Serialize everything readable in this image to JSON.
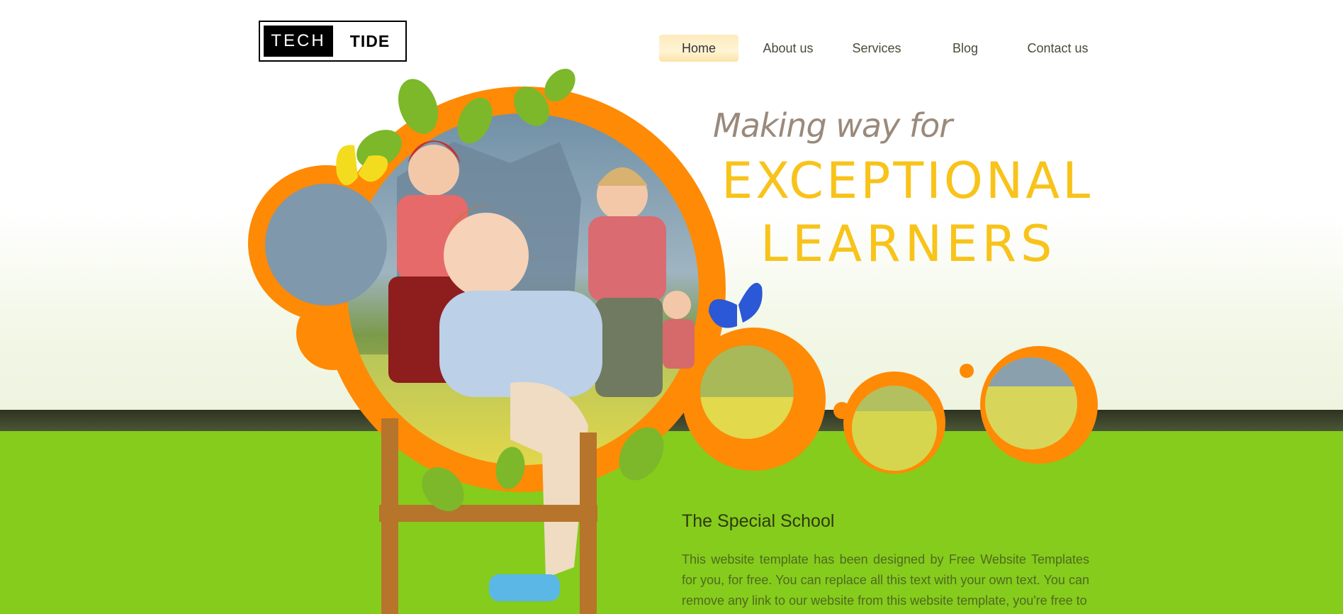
{
  "logo": {
    "part1": "TECH",
    "part2": "TIDE"
  },
  "nav": {
    "items": [
      {
        "label": "Home",
        "active": true
      },
      {
        "label": "About us",
        "active": false
      },
      {
        "label": "Services",
        "active": false
      },
      {
        "label": "Blog",
        "active": false
      },
      {
        "label": "Contact us",
        "active": false
      }
    ]
  },
  "hero": {
    "tagline": "Making way for",
    "headline_line1": "EXCEPTIONAL",
    "headline_line2": "LEARNERS"
  },
  "content": {
    "title": "The Special School",
    "body": "This website template has been designed by Free Website Templates for you, for free. You can replace all this text with your own text. You can remove any link to our website from this website template, you're free to"
  },
  "colors": {
    "accent_orange": "#ff8a05",
    "headline_yellow": "#f8c31a",
    "green": "#86cc1c",
    "band": "#3a4229"
  }
}
